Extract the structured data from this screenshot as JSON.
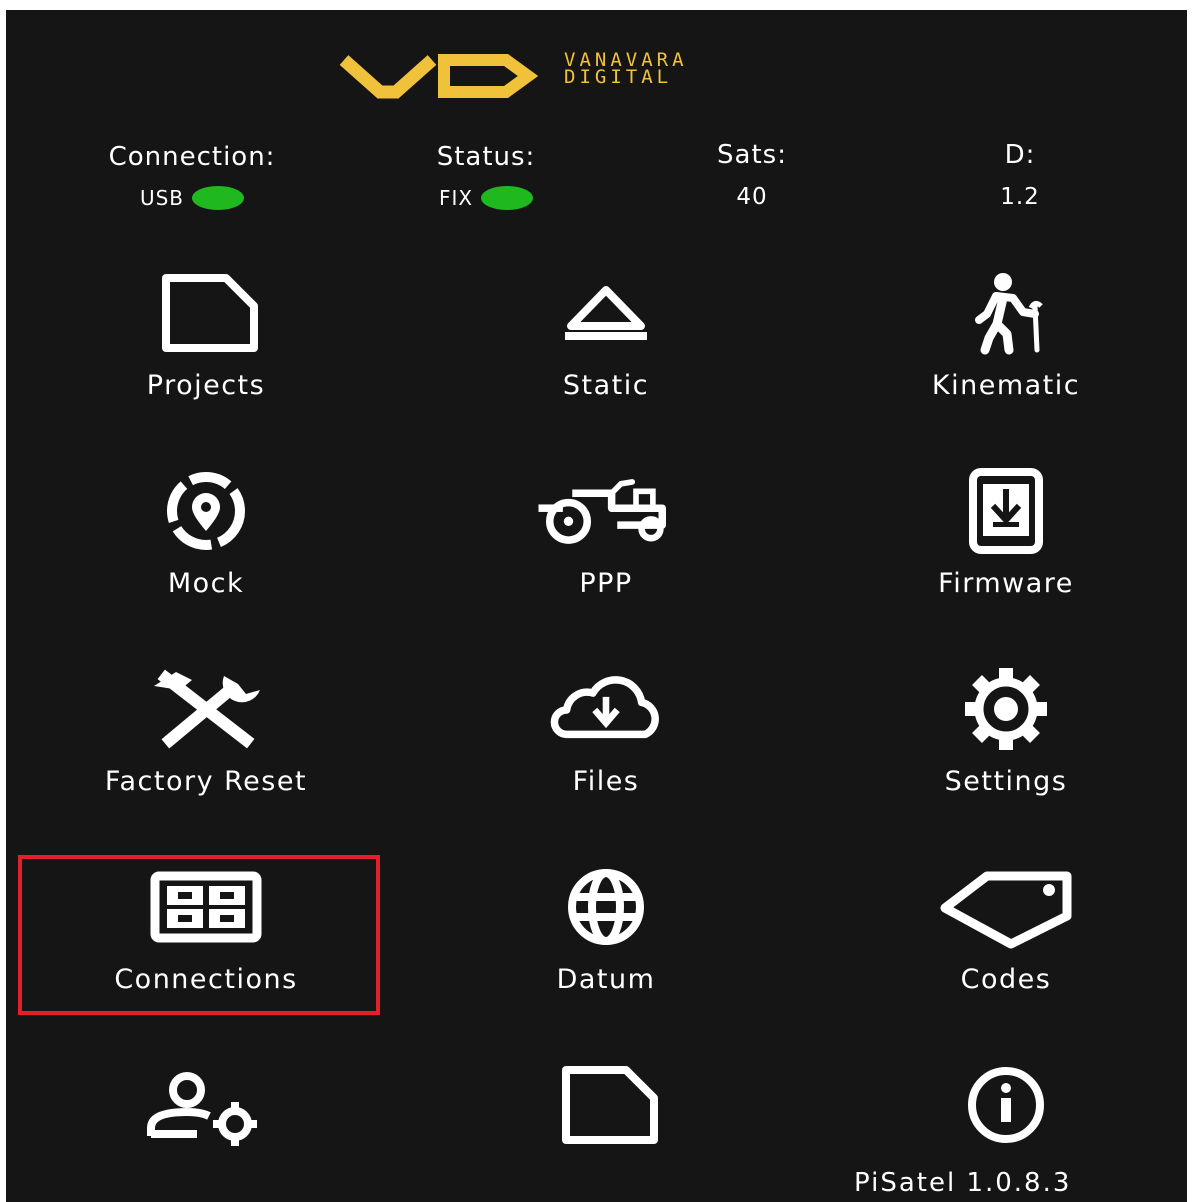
{
  "brand": {
    "logo_letters": "VD",
    "name_line1": "VANAVARA",
    "name_line2": "DIGITAL",
    "color": "#f0c13b"
  },
  "status_bar": {
    "connection": {
      "label": "Connection:",
      "value": "USB",
      "indicator_color": "#1fb81f"
    },
    "status": {
      "label": "Status:",
      "value": "FIX",
      "indicator_color": "#1fb81f"
    },
    "sats": {
      "label": "Sats:",
      "value": "40"
    },
    "d": {
      "label": "D:",
      "value": "1.2"
    }
  },
  "menu": [
    {
      "label": "Projects",
      "icon": "document-icon"
    },
    {
      "label": "Static",
      "icon": "eject-icon"
    },
    {
      "label": "Kinematic",
      "icon": "walking-person-icon"
    },
    {
      "label": "Mock",
      "icon": "location-target-icon"
    },
    {
      "label": "PPP",
      "icon": "tractor-icon"
    },
    {
      "label": "Firmware",
      "icon": "phone-download-icon"
    },
    {
      "label": "Factory Reset",
      "icon": "tools-icon"
    },
    {
      "label": "Files",
      "icon": "cloud-download-icon"
    },
    {
      "label": "Settings",
      "icon": "gear-icon"
    },
    {
      "label": "Connections",
      "icon": "grid-panel-icon",
      "highlighted": true
    },
    {
      "label": "Datum",
      "icon": "globe-icon"
    },
    {
      "label": "Codes",
      "icon": "tag-icon"
    },
    {
      "label": "",
      "icon": "user-settings-icon"
    },
    {
      "label": "",
      "icon": "document-icon"
    },
    {
      "label": "",
      "icon": "info-icon"
    }
  ],
  "highlight_color": "#e0202a",
  "version": "PiSatel 1.0.8.3"
}
